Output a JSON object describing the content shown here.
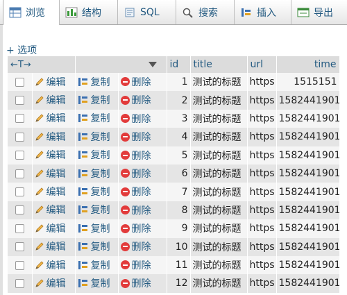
{
  "tabs": [
    {
      "label": "浏览",
      "icon": "table-browse-icon",
      "active": true
    },
    {
      "label": "结构",
      "icon": "structure-icon",
      "active": false
    },
    {
      "label": "SQL",
      "icon": "sql-icon",
      "active": false
    },
    {
      "label": "搜索",
      "icon": "search-icon",
      "active": false
    },
    {
      "label": "插入",
      "icon": "insert-icon",
      "active": false
    },
    {
      "label": "导出",
      "icon": "export-icon",
      "active": false
    }
  ],
  "options_label": "+ 选项",
  "table": {
    "headers": {
      "arrows": "←T→",
      "id": "id",
      "title": "title",
      "url": "url",
      "time": "time"
    },
    "actions": {
      "edit": "编辑",
      "copy": "复制",
      "delete": "删除"
    },
    "rows": [
      {
        "id": "1",
        "title": "测试的标题",
        "url": "https",
        "time": "1515151"
      },
      {
        "id": "2",
        "title": "测试的标题",
        "url": "https",
        "time": "1582441901"
      },
      {
        "id": "3",
        "title": "测试的标题",
        "url": "https",
        "time": "1582441901"
      },
      {
        "id": "4",
        "title": "测试的标题",
        "url": "https",
        "time": "1582441901"
      },
      {
        "id": "5",
        "title": "测试的标题",
        "url": "https",
        "time": "1582441901"
      },
      {
        "id": "6",
        "title": "测试的标题",
        "url": "https",
        "time": "1582441901"
      },
      {
        "id": "7",
        "title": "测试的标题",
        "url": "https",
        "time": "1582441901"
      },
      {
        "id": "8",
        "title": "测试的标题",
        "url": "https",
        "time": "1582441901"
      },
      {
        "id": "9",
        "title": "测试的标题",
        "url": "https",
        "time": "1582441901"
      },
      {
        "id": "10",
        "title": "测试的标题",
        "url": "https",
        "time": "1582441901"
      },
      {
        "id": "11",
        "title": "测试的标题",
        "url": "https",
        "time": "1582441901"
      },
      {
        "id": "12",
        "title": "测试的标题",
        "url": "https",
        "time": "1582441901"
      }
    ]
  },
  "colors": {
    "link": "#235a81",
    "delete": "#e23b3b",
    "row_odd": "#f5f5f5",
    "row_even": "#e5e5e5",
    "header": "#dcdcdc"
  }
}
